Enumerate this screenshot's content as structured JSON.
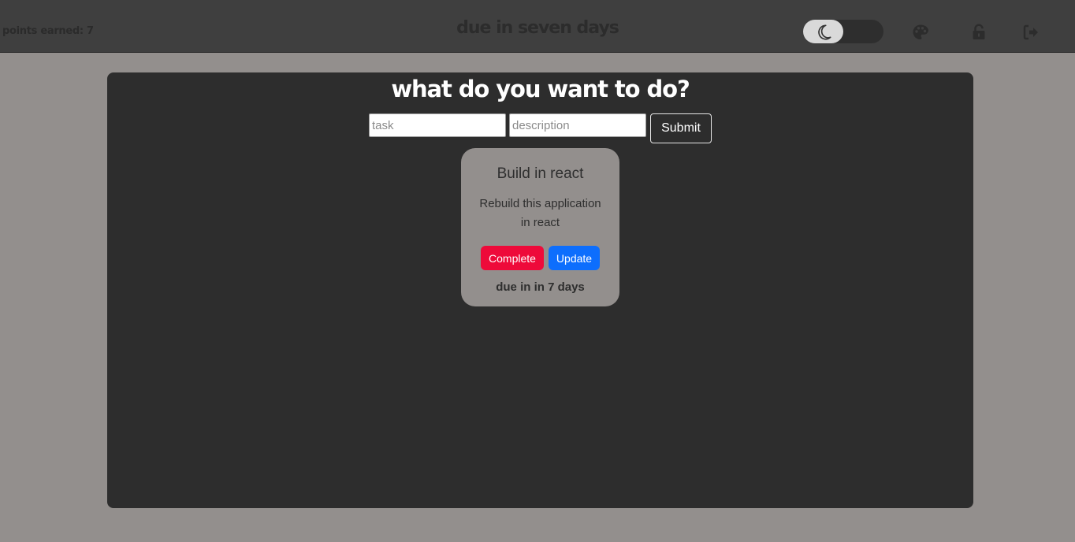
{
  "header": {
    "points_label": "points earned: 7",
    "title": "due in seven days",
    "theme_toggle": {
      "icon": "moon-icon",
      "state": "dark"
    },
    "icons": [
      "palette-icon",
      "unlock-icon",
      "sign-out-icon"
    ]
  },
  "main": {
    "heading": "what do you want to do?",
    "task_input": {
      "value": "",
      "placeholder": "task"
    },
    "description_input": {
      "value": "",
      "placeholder": "description"
    },
    "submit_label": "Submit"
  },
  "tasks": [
    {
      "title": "Build in react",
      "description": "Rebuild this application in react",
      "complete_label": "Complete",
      "update_label": "Update",
      "due": "due in in 7 days"
    }
  ],
  "colors": {
    "page_background": "#938f8d",
    "header_background": "#3f3f3f",
    "panel_background": "#2d2d2d",
    "complete_button": "#ee0a3a",
    "update_button": "#0d6efd"
  }
}
